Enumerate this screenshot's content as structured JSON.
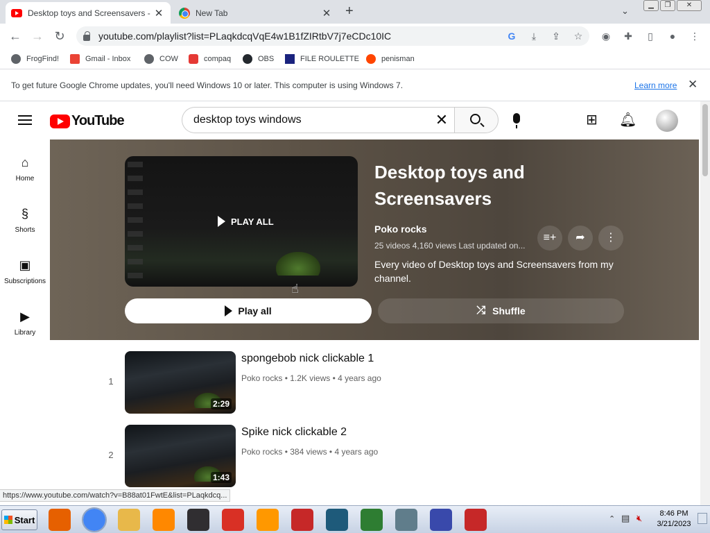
{
  "browser": {
    "tabs": [
      {
        "title": "Desktop toys and Screensavers - Yo",
        "active": true
      },
      {
        "title": "New Tab",
        "active": false
      }
    ],
    "new_tab": "+",
    "url": "youtube.com/playlist?list=PLaqkdcqVqE4w1B1fZIRtbV7j7eCDc10IC",
    "bookmarks": [
      {
        "label": "FrogFind!",
        "color": "#5f6368"
      },
      {
        "label": "Gmail - Inbox",
        "color": "#ea4335"
      },
      {
        "label": "COW",
        "color": "#5f6368"
      },
      {
        "label": "compaq",
        "color": "#e53935"
      },
      {
        "label": "OBS",
        "color": "#24292e"
      },
      {
        "label": "FILE ROULETTE",
        "color": "#1a237e"
      },
      {
        "label": "penisman",
        "color": "#ff4500"
      }
    ],
    "infobar": {
      "message": "To get future Google Chrome updates, you'll need Windows 10 or later. This computer is using Windows 7.",
      "link": "Learn more"
    },
    "status_url": "https://www.youtube.com/watch?v=B88at01FwtE&list=PLaqkdcq..."
  },
  "youtube": {
    "logo": "YouTube",
    "search_value": "desktop toys windows",
    "sidebar": [
      {
        "label": "Home",
        "icon": "home-icon"
      },
      {
        "label": "Shorts",
        "icon": "shorts-icon"
      },
      {
        "label": "Subscriptions",
        "icon": "subscriptions-icon"
      },
      {
        "label": "Library",
        "icon": "library-icon"
      }
    ],
    "playlist": {
      "title": "Desktop toys and Screensavers",
      "owner": "Poko rocks",
      "meta": "25 videos  4,160 views  Last updated on...",
      "description": "Every video of Desktop toys and Screensavers from my channel.",
      "thumb_overlay": "PLAY ALL",
      "play_all": "Play all",
      "shuffle": "Shuffle"
    },
    "videos": [
      {
        "index": "1",
        "title": "spongebob nick clickable 1",
        "meta": "Poko rocks • 1.2K views • 4 years ago",
        "duration": "2:29"
      },
      {
        "index": "2",
        "title": "Spike nick clickable 2",
        "meta": "Poko rocks • 384 views • 4 years ago",
        "duration": "1:43"
      }
    ]
  },
  "taskbar": {
    "start": "Start",
    "time": "8:46 PM",
    "date": "3/21/2023",
    "apps": [
      {
        "name": "firefox",
        "color": "#e66000"
      },
      {
        "name": "chrome",
        "color": "#4285f4"
      },
      {
        "name": "file-explorer",
        "color": "#e8b84a"
      },
      {
        "name": "vlc",
        "color": "#ff8800"
      },
      {
        "name": "obs",
        "color": "#302e31"
      },
      {
        "name": "gmail",
        "color": "#d93025"
      },
      {
        "name": "search-app",
        "color": "#ff9800"
      },
      {
        "name": "dev-cpp",
        "color": "#c62828"
      },
      {
        "name": "app-blue",
        "color": "#1e5a7a"
      },
      {
        "name": "audio-app",
        "color": "#2e7d32"
      },
      {
        "name": "notepad-app",
        "color": "#607d8b"
      },
      {
        "name": "infinity-app",
        "color": "#3949ab"
      },
      {
        "name": "red-app",
        "color": "#c62828"
      }
    ]
  }
}
